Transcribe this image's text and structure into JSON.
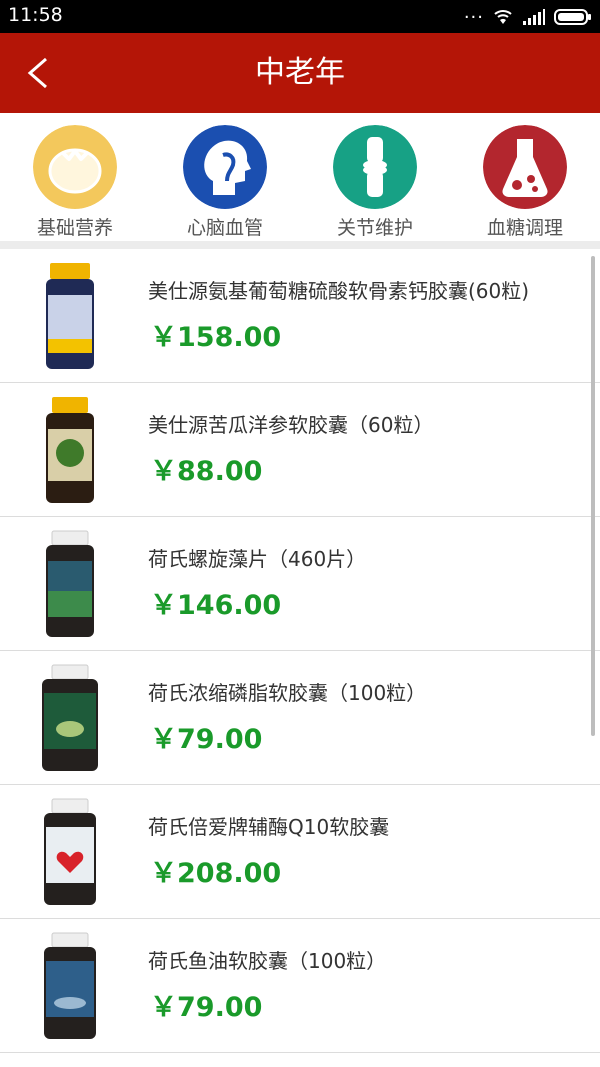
{
  "status": {
    "time": "11:58"
  },
  "header": {
    "title": "中老年"
  },
  "categories": [
    {
      "label": "基础营养",
      "icon": "tomato-icon",
      "color": "#f3c85c"
    },
    {
      "label": "心脑血管",
      "icon": "head-profile-icon",
      "color": "#1b4fb0"
    },
    {
      "label": "关节维护",
      "icon": "joint-bone-icon",
      "color": "#17a185"
    },
    {
      "label": "血糖调理",
      "icon": "flask-icon",
      "color": "#b3262e"
    }
  ],
  "products": [
    {
      "name": "美仕源氨基葡萄糖硫酸软骨素钙胶囊(60粒)",
      "price": "￥158.00",
      "image": "supplement-bottle-yellow-cap"
    },
    {
      "name": "美仕源苦瓜洋参软胶囊（60粒）",
      "price": "￥88.00",
      "image": "supplement-bottle-yellow-cap"
    },
    {
      "name": "荷氏螺旋藻片（460片）",
      "price": "￥146.00",
      "image": "supplement-bottle-white-cap"
    },
    {
      "name": "荷氏浓缩磷脂软胶囊（100粒）",
      "price": "￥79.00",
      "image": "supplement-bottle-white-cap"
    },
    {
      "name": "荷氏倍爱牌辅酶Q10软胶囊",
      "price": "￥208.00",
      "image": "supplement-bottle-white-cap"
    },
    {
      "name": "荷氏鱼油软胶囊（100粒）",
      "price": "￥79.00",
      "image": "supplement-bottle-white-cap"
    }
  ]
}
